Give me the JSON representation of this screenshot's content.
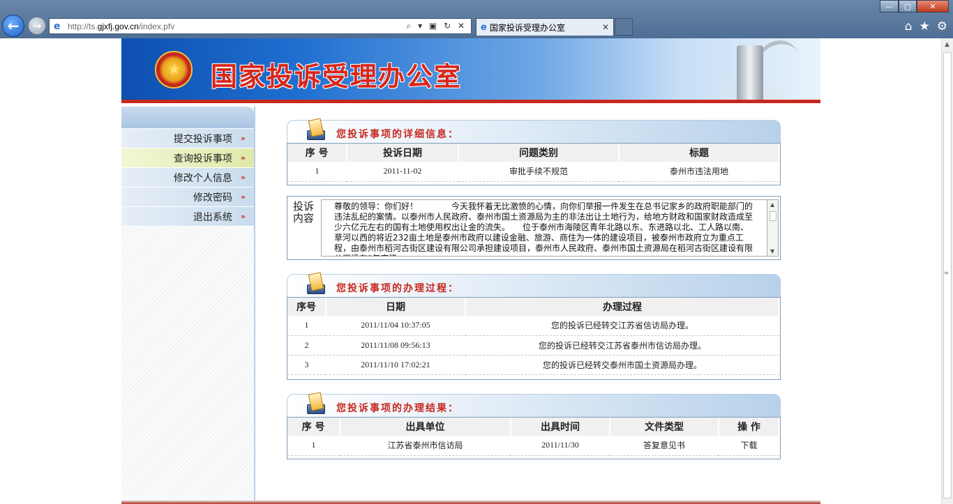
{
  "browser": {
    "url_prefix": "http://ts.",
    "url_domain": "gjxfj.gov.cn",
    "url_path": "/index.pfv",
    "address_tools": "⌕ ▾ ▣ ↻ ✕",
    "tab_title": "国家投诉受理办公室",
    "tab_close": "✕",
    "back_icon": "←",
    "forward_icon": "→",
    "win_min": "—",
    "win_max": "▢",
    "win_close": "✕",
    "tools": [
      "⌂",
      "★",
      "⚙"
    ]
  },
  "banner": {
    "title": "国家投诉受理办公室",
    "emblem_glyph": "★"
  },
  "sidebar": {
    "items": [
      {
        "label": "提交投诉事项",
        "arrow": "»"
      },
      {
        "label": "查询投诉事项",
        "arrow": "»"
      },
      {
        "label": "修改个人信息",
        "arrow": "»"
      },
      {
        "label": "修改密码",
        "arrow": "»"
      },
      {
        "label": "退出系统",
        "arrow": "»"
      }
    ]
  },
  "detail": {
    "title": "您投诉事项的详细信息：",
    "headers": [
      "序 号",
      "投诉日期",
      "问题类别",
      "标题"
    ],
    "rows": [
      {
        "no": "1",
        "date": "2011-11-02",
        "category": "审批手续不规范",
        "subject": "泰州市违法用地"
      }
    ]
  },
  "complaint": {
    "label": "投诉内容",
    "text": "尊敬的领导：你们好！　　　　今天我怀着无比激愤的心情，向你们举报一件发生在总书记家乡的政府职能部门的违法乱纪的案情。以泰州市人民政府、泰州市国土资源局为主的非法出让土地行为，给地方财政和国家财政造成至少六亿元左右的国有土地使用权出让金的流失。　　位于泰州市海陵区青年北路以东、东进路以北、工人路以南、草河以西的将近232亩土地是泰州市政府以建设金融、旅游、商住为一体的建设项目，被泰州市政府立为重点工程，由泰州市稻河古街区建设有限公司承担建设项目，泰州市人民政府、泰州市国土资源局在稻河古街区建设有限公司没有”年度建"
  },
  "process": {
    "title": "您投诉事项的办理过程：",
    "headers": [
      "序号",
      "日期",
      "办理过程"
    ],
    "rows": [
      {
        "no": "1",
        "date": "2011/11/04 10:37:05",
        "desc": "您的投诉已经转交江苏省信访局办理。"
      },
      {
        "no": "2",
        "date": "2011/11/08 09:56:13",
        "desc": "您的投诉已经转交江苏省泰州市信访局办理。"
      },
      {
        "no": "3",
        "date": "2011/11/10 17:02:21",
        "desc": "您的投诉已经转交泰州市国土资源局办理。"
      }
    ]
  },
  "result": {
    "title": "您投诉事项的办理结果：",
    "headers": [
      "序 号",
      "出具单位",
      "出具时间",
      "文件类型",
      "操  作"
    ],
    "rows": [
      {
        "no": "1",
        "unit": "江苏省泰州市信访局",
        "time": "2011/11/30",
        "type": "答复意见书",
        "action": "下载"
      }
    ]
  }
}
